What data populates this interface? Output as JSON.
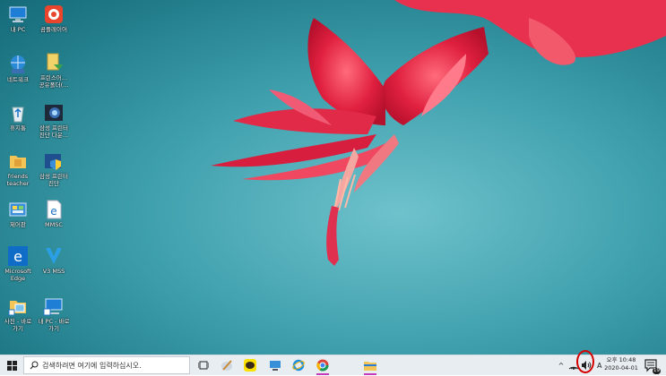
{
  "desktop": {
    "icons": [
      {
        "label": "내 PC"
      },
      {
        "label": "곰플레이어"
      },
      {
        "label": "네트워크"
      },
      {
        "label": "프린스어... 공유폴더(..."
      },
      {
        "label": "휴지통"
      },
      {
        "label": "삼성 프린터 진단 다운..."
      },
      {
        "label": "friends teacher"
      },
      {
        "label": "삼성 프린터 진단"
      },
      {
        "label": "제어판"
      },
      {
        "label": "MMSC"
      },
      {
        "label": "Microsoft Edge"
      },
      {
        "label": "V3 MSS"
      },
      {
        "label": "사진 - 바로 가기"
      },
      {
        "label": "내 PC - 바로 가기"
      }
    ]
  },
  "taskbar": {
    "search_placeholder": "검색하려면 여기에 입력하십시오.",
    "tray_ime": "A",
    "clock_ampm_time": "오후 10:48",
    "clock_date": "2020-04-01",
    "notification_count": "19"
  },
  "colors": {
    "taskbar_bg": "#e8edf2",
    "highlight": "#d40000",
    "active_app_underline": "#c23bbf"
  }
}
